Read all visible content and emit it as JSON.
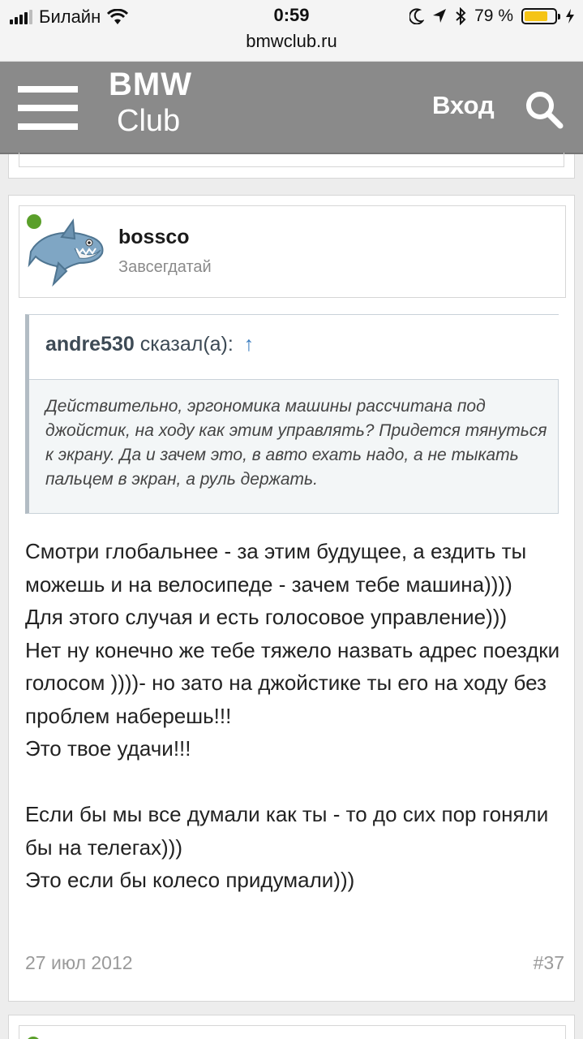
{
  "status_bar": {
    "carrier": "Билайн",
    "time": "0:59",
    "url": "bmwclub.ru",
    "battery": "79 %",
    "battery_level": 0.79
  },
  "header": {
    "logo_top": "BMW",
    "logo_bottom": "Club",
    "login_label": "Вход"
  },
  "post": {
    "author": "bossco",
    "author_title": "Завсегдатай",
    "quote": {
      "author": "andre530",
      "said": "сказал(а):",
      "arrow": "↑",
      "text": "Действительно, эргономика машины рассчитана под джойстик, на ходу как этим управлять? Придется тянуться к экрану. Да и зачем это, в авто ехать надо, а не тыкать пальцем в экран, а руль держать."
    },
    "message_lines": [
      "Смотри глобальнее - за этим будущее, а ездить ты можешь и на велосипеде - зачем тебе машина))))",
      "Для этого случая и есть голосовое управление)))",
      "Нет ну конечно же тебе тяжело назвать адрес поездки голосом ))))- но зато на джойстике ты его на ходу без проблем наберешь!!!",
      "Это твое удачи!!!",
      "",
      "Если бы мы все думали как ты - то до сих пор гоняли бы на телегах)))",
      "Это если бы колесо придумали)))"
    ],
    "date": "27 июл 2012",
    "number": "#37"
  }
}
